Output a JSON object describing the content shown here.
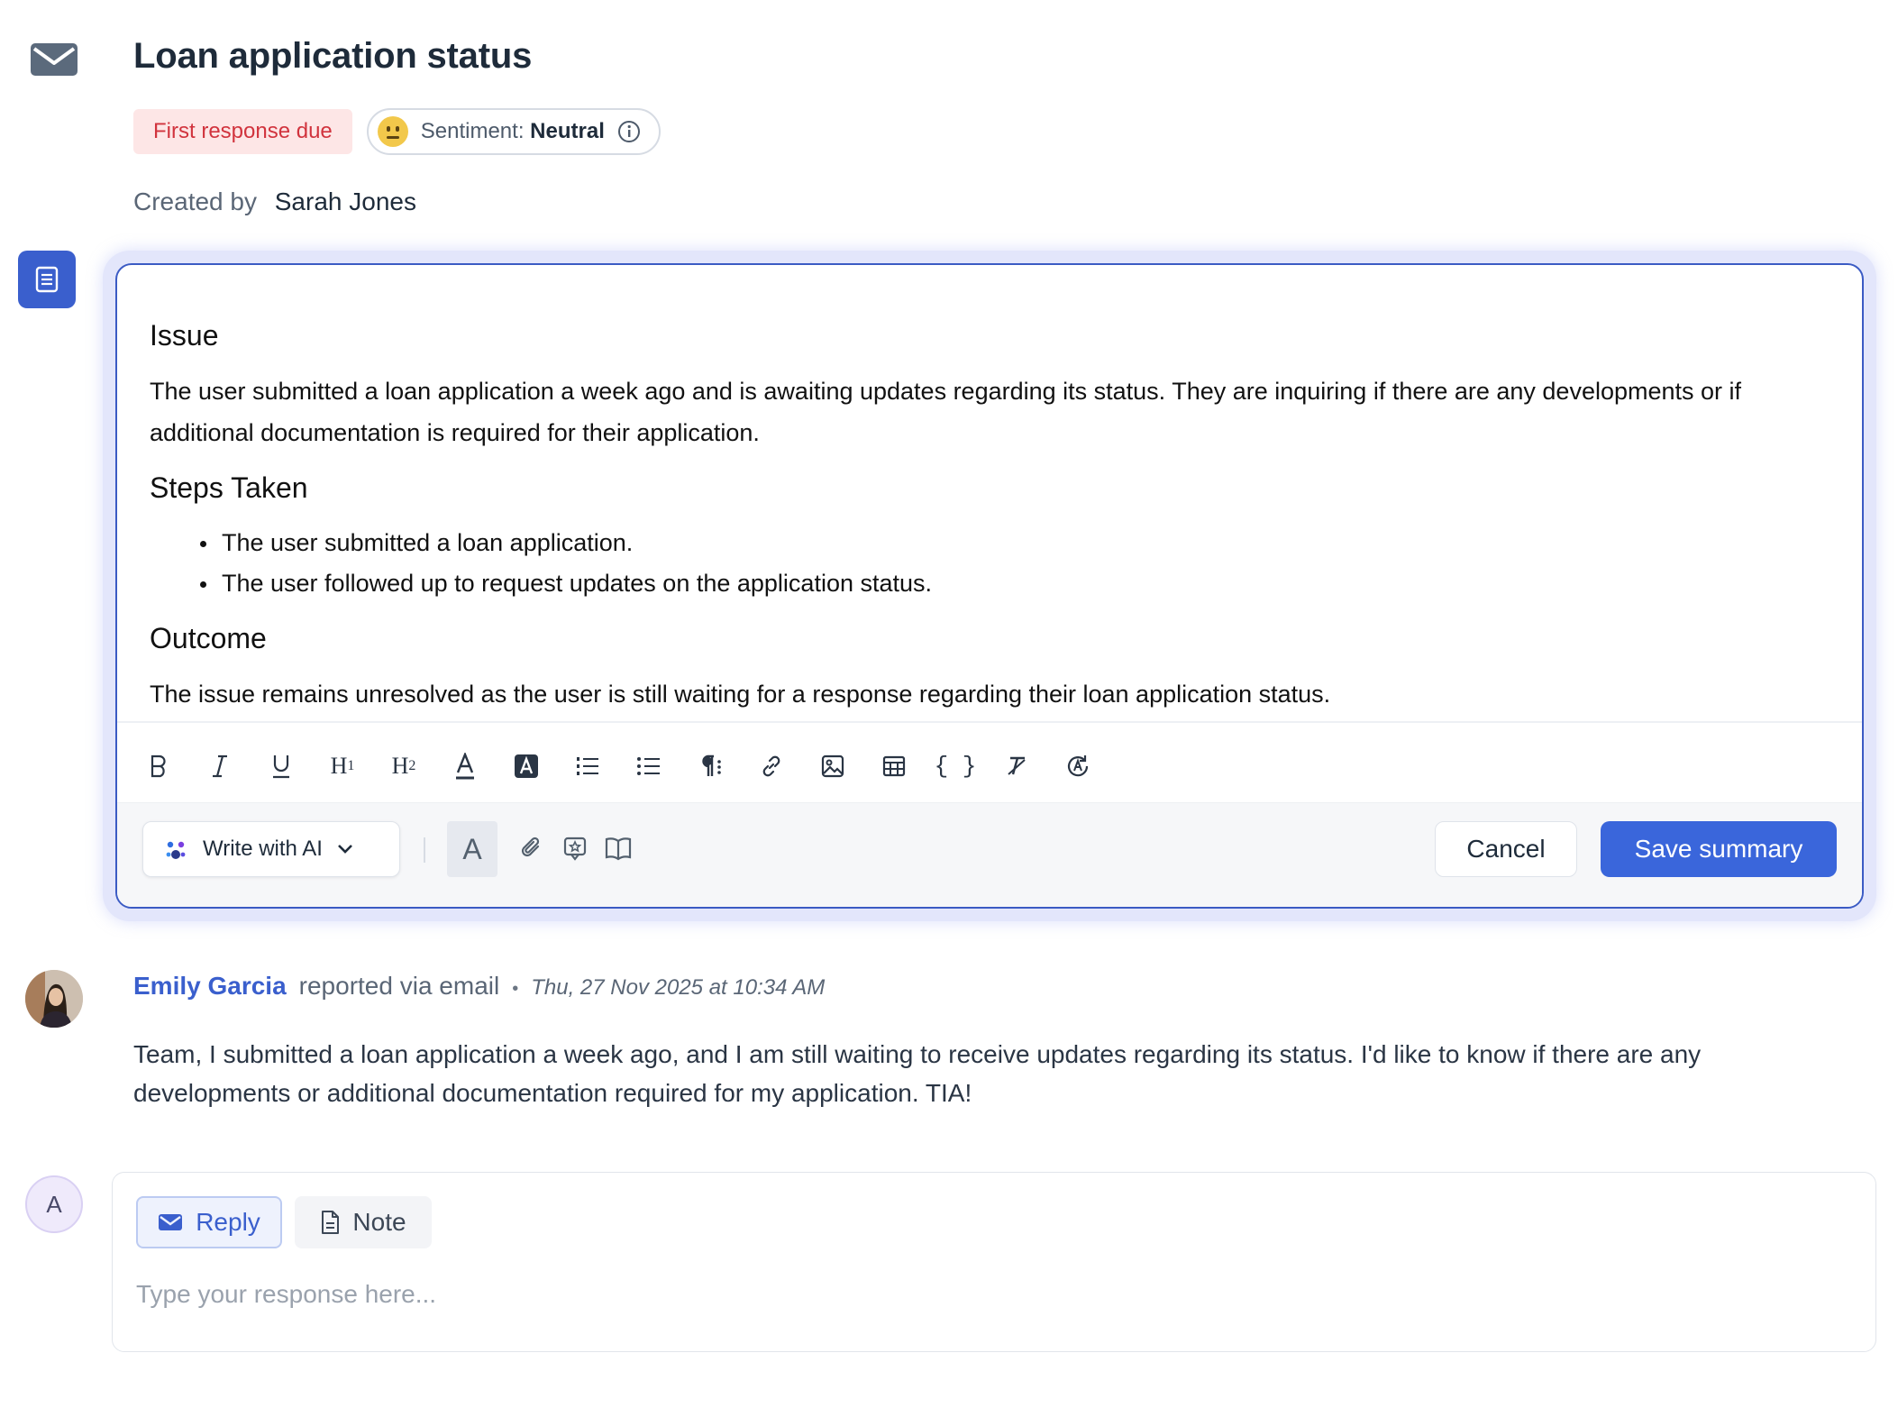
{
  "ticket": {
    "title": "Loan application status",
    "status_tag": "First response due",
    "sentiment_label": "Sentiment:",
    "sentiment_value": "Neutral",
    "created_by_label": "Created by",
    "created_by_name": "Sarah Jones"
  },
  "summary": {
    "issue_heading": "Issue",
    "issue_text": "The user submitted a loan application a week ago and is awaiting updates regarding its status. They are inquiring if there are any developments or if additional documentation is required for their application.",
    "steps_heading": "Steps Taken",
    "steps": [
      "The user submitted a loan application.",
      "The user followed up to request updates on the application status."
    ],
    "outcome_heading": "Outcome",
    "outcome_text": "The issue remains unresolved as the user is still waiting for a response regarding their loan application status."
  },
  "toolbar": {
    "icons": [
      "bold-icon",
      "italic-icon",
      "underline-icon",
      "heading1-icon",
      "heading2-icon",
      "text-color-icon",
      "highlight-icon",
      "ordered-list-icon",
      "bullet-list-icon",
      "paragraph-icon",
      "link-icon",
      "image-icon",
      "table-icon",
      "code-block-icon",
      "clear-format-icon",
      "auto-format-icon"
    ],
    "h1": "H",
    "h2": "H",
    "h1_sub": "1",
    "h2_sub": "2",
    "code": "{ }"
  },
  "actions": {
    "write_ai_label": "Write with AI",
    "font_glyph": "A",
    "cancel_label": "Cancel",
    "save_label": "Save summary"
  },
  "message": {
    "author": "Emily Garcia",
    "channel": "reported via email",
    "separator": "•",
    "timestamp": "Thu, 27 Nov 2025 at 10:34 AM",
    "body": "Team, I submitted a loan application a week ago, and I am still waiting to receive updates regarding its status. I'd like to know if there are any developments or additional documentation required for my application. TIA!"
  },
  "composer": {
    "avatar_initial": "A",
    "reply_label": "Reply",
    "note_label": "Note",
    "placeholder": "Type your response here..."
  },
  "colors": {
    "accent": "#3a66db",
    "brand_blue": "#3a5fcd",
    "due_red": "#d1333d",
    "due_bg": "#fde6e6"
  }
}
